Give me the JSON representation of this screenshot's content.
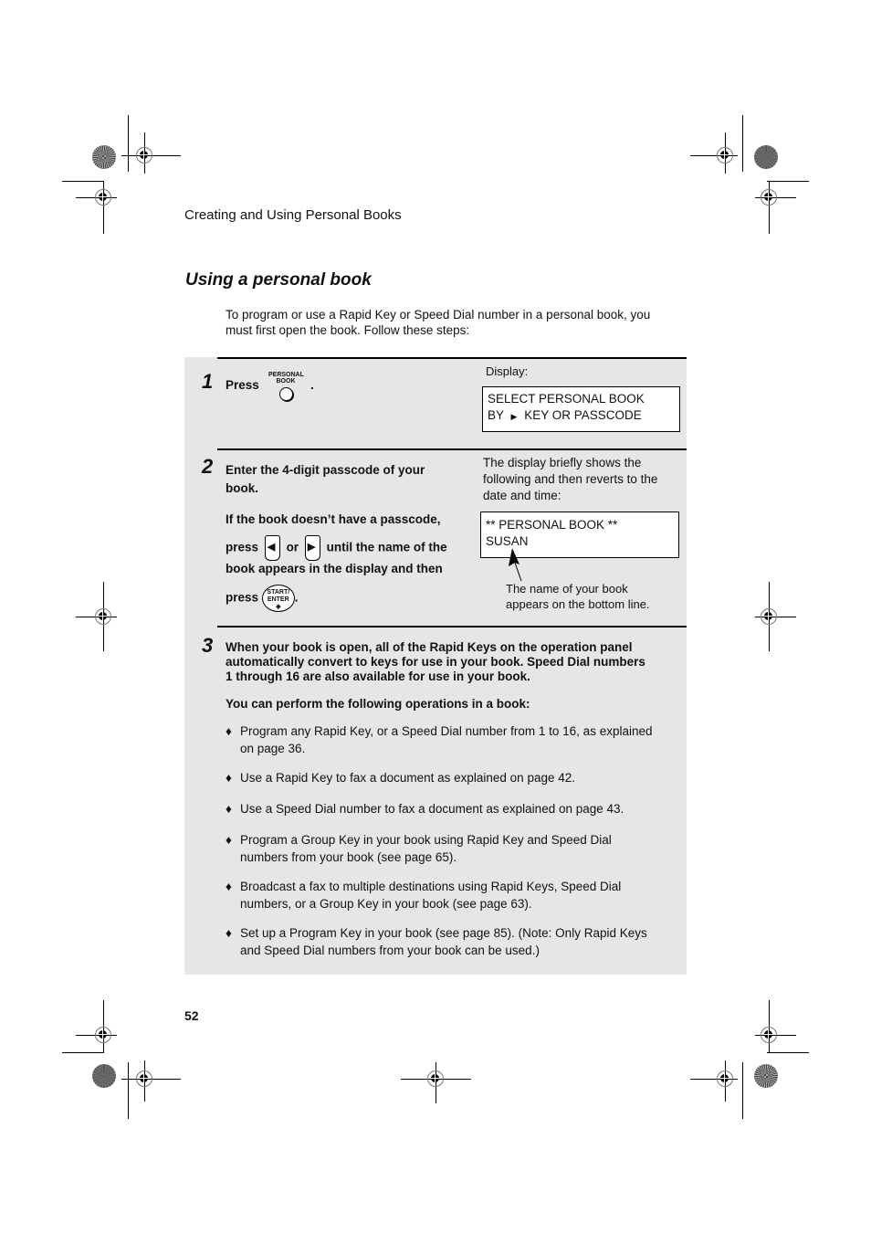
{
  "header": {
    "running_head": "Creating and Using Personal Books"
  },
  "section": {
    "title": "Using a personal book",
    "intro_line1": "To program or use a Rapid Key or Speed Dial number in a personal book, you",
    "intro_line2": "must first open the book. Follow these steps:"
  },
  "steps": [
    {
      "number": "1",
      "press_label": "Press",
      "key_label_top": "PERSONAL",
      "key_label_bottom": "BOOK",
      "trailing": ".",
      "display_caption": "Display:",
      "display_line1": "SELECT PERSONAL BOOK",
      "display_line2_prefix": "BY",
      "display_line2_suffix": "KEY OR PASSCODE",
      "display_arrow": "▶"
    },
    {
      "number": "2",
      "line1": "Enter the 4-digit passcode of your",
      "line2": "book.",
      "line3": "If the book doesn’t have a passcode,",
      "line4_press": "press",
      "line4_or": "or",
      "line4_rest": "until the name of the",
      "line5": "book appears in the display and then",
      "line6_press": "press",
      "line6_trailing": ".",
      "left_arrow": "◀",
      "right_arrow": "▶",
      "start_key_top": "START/",
      "start_key_bottom": "ENTER",
      "start_key_symbol": "◈",
      "note_line1": "The display briefly shows the",
      "note_line2": "following and then reverts to the",
      "note_line3": "date and time:",
      "display_line1": "** PERSONAL BOOK **",
      "display_line2": "SUSAN",
      "callout_line1": "The name of your book",
      "callout_line2": "appears on the bottom line."
    },
    {
      "number": "3",
      "para_line1": "When your book is open, all of the Rapid Keys on the operation panel",
      "para_line2": "automatically convert to keys for use in your book. Speed Dial numbers",
      "para_line3": "1 through 16 are also available for use in your book.",
      "operations_intro": "You can perform the following operations in a book:",
      "bullet_glyph": "♦",
      "bullets": [
        {
          "line1": "Program any Rapid Key, or a Speed Dial number from 1 to 16, as explained",
          "line2": "on page 36."
        },
        {
          "line1": "Use a Rapid Key to fax a document as explained on page 42.",
          "line2": ""
        },
        {
          "line1": "Use a Speed Dial number to fax a document as explained on page 43.",
          "line2": ""
        },
        {
          "line1": "Program a Group Key in your book using Rapid Key and Speed Dial",
          "line2": "numbers from your book (see page 65)."
        },
        {
          "line1": "Broadcast a fax to multiple destinations using Rapid Keys, Speed Dial",
          "line2": "numbers, or a Group Key in your book (see page 63)."
        },
        {
          "line1": "Set up a Program Key in your book (see page 85). (Note: Only Rapid Keys",
          "line2": "and Speed Dial numbers from your book can be used.)"
        }
      ]
    }
  ],
  "footer": {
    "page_number": "52"
  }
}
